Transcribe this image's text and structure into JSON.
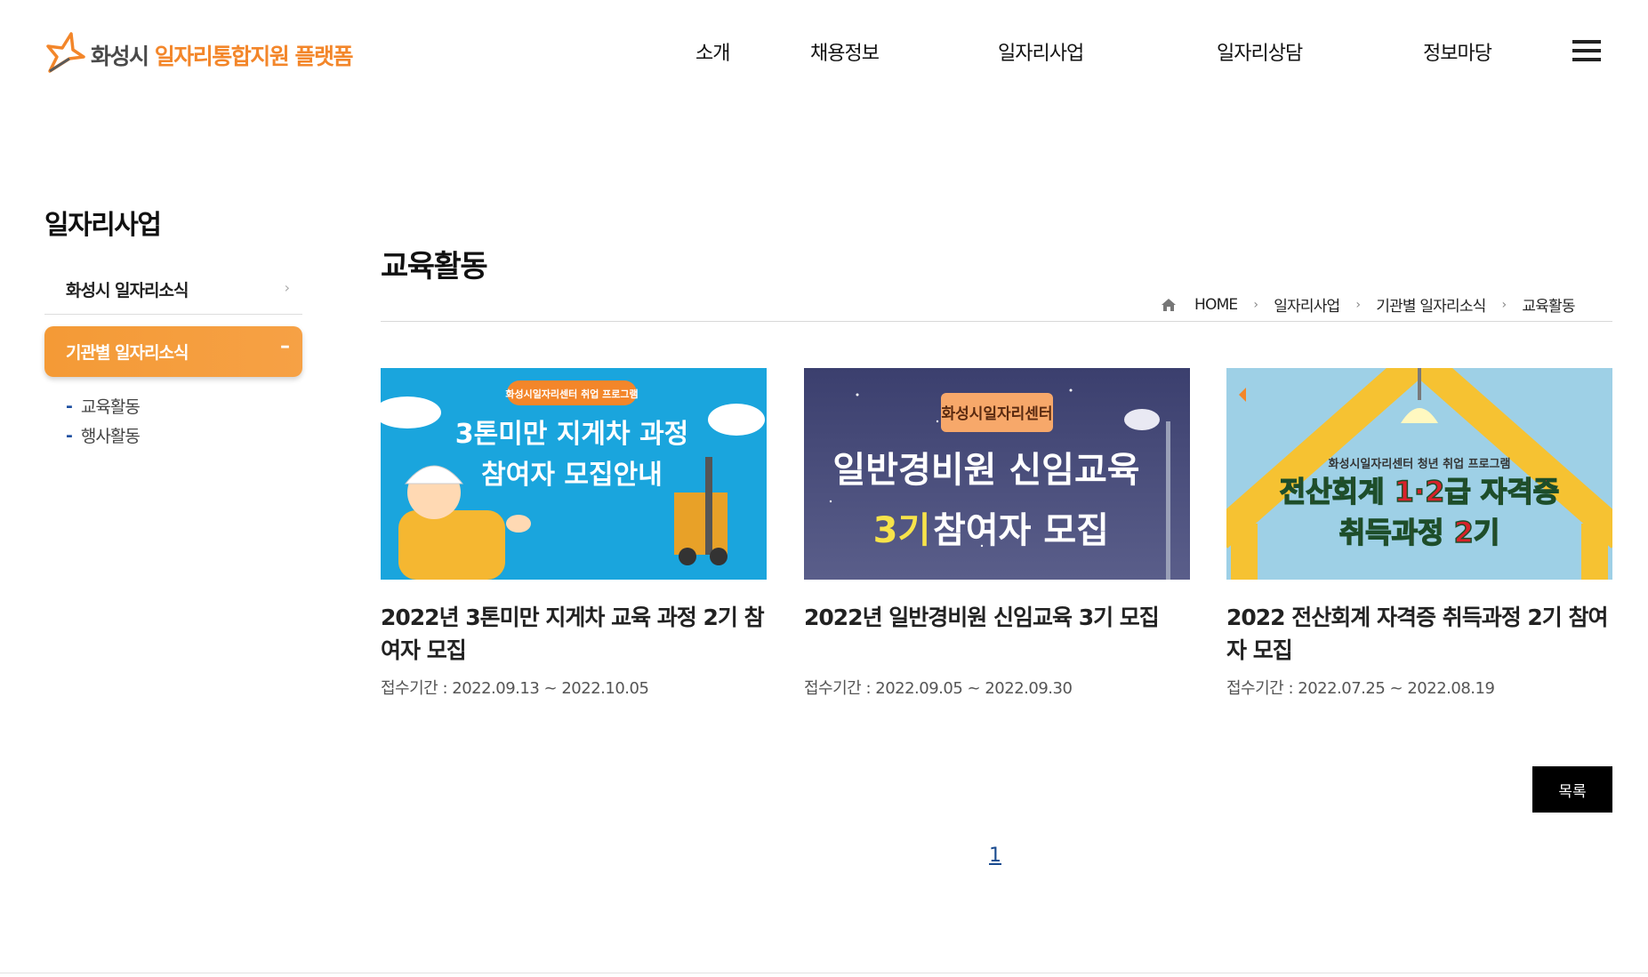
{
  "header": {
    "logo_city": "화성시",
    "logo_name": "일자리통합지원 플랫폼",
    "nav": [
      "소개",
      "채용정보",
      "일자리사업",
      "일자리상담",
      "정보마당"
    ]
  },
  "sidebar": {
    "title": "일자리사업",
    "items": [
      {
        "label": "화성시 일자리소식"
      },
      {
        "label": "기관별 일자리소식"
      }
    ],
    "sub_items": [
      "교육활동",
      "행사활동"
    ]
  },
  "main": {
    "page_title": "교육활동",
    "breadcrumb": [
      "HOME",
      "일자리사업",
      "기관별 일자리소식",
      "교육활동"
    ],
    "cards": [
      {
        "title": "2022년 3톤미만 지게차 교육 과정 2기 참여자 모집",
        "date": "접수기간 : 2022.09.13 ~ 2022.10.05",
        "thumb_badge": "화성시일자리센터 취업 프로그램",
        "thumb_line1": "3톤미만 지게차 과정",
        "thumb_line2": "참여자 모집안내"
      },
      {
        "title": "2022년 일반경비원 신임교육 3기 모집",
        "date": "접수기간 : 2022.09.05 ~ 2022.09.30",
        "thumb_badge": "화성시일자리센터",
        "thumb_line1": "일반경비원 신임교육",
        "thumb_line2a": "3기",
        "thumb_line2b": "참여자 모집"
      },
      {
        "title": "2022 전산회계 자격증 취득과정 2기 참여자 모집",
        "date": "접수기간 : 2022.07.25 ~ 2022.08.19",
        "thumb_badge": "화성시일자리센터 청년 취업 프로그램",
        "thumb_line1": "전산회계 1·2급 자격증",
        "thumb_line2": "취득과정 2기"
      }
    ],
    "list_button": "목록",
    "page": "1"
  },
  "colors": {
    "accent_orange": "#f3862a",
    "sidebar_active": "#f49a36",
    "page_link": "#1a4b8f"
  }
}
